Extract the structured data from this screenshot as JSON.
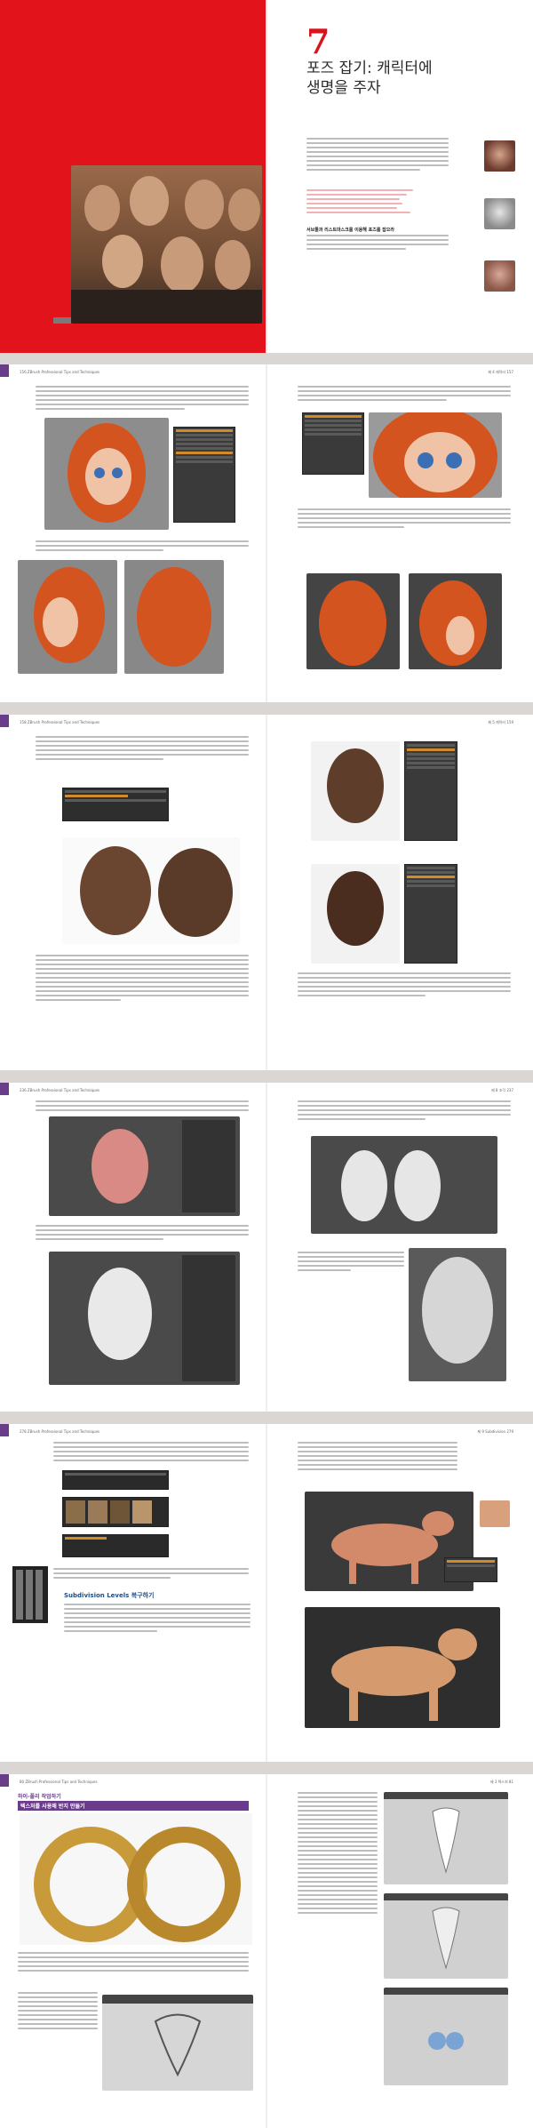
{
  "chapter": {
    "number": "7",
    "title_line1": "포즈 잡기: 캐릭터에",
    "title_line2": "생명을 주자",
    "bullets": [
      "",
      "",
      "",
      "",
      "",
      ""
    ],
    "subhead": "서브툴과 리스트마스크를 이용해 포즈를 잡으라"
  },
  "spreads": [
    {
      "left_folio": "156",
      "right_folio": "157",
      "left_head": "ZBrush Professional Tips and Techniques",
      "right_head": "제 4 캐릭터"
    },
    {
      "left_folio": "158",
      "right_folio": "159",
      "left_head": "ZBrush Professional Tips and Techniques",
      "right_head": "제 5 캐릭터"
    },
    {
      "left_folio": "236",
      "right_folio": "237",
      "left_head": "ZBrush Professional Tips and Techniques",
      "right_head": "제 8 조각"
    },
    {
      "left_folio": "278",
      "right_folio": "279",
      "left_head": "ZBrush Professional Tips and Techniques",
      "right_head": "제 9 Subdivision"
    },
    {
      "left_folio": "80",
      "right_folio": "81",
      "left_head": "ZBrush Professional Tips and Techniques",
      "right_head": "제 3 텍스처"
    }
  ],
  "section": {
    "subdivision_heading": "Subdivision Levels 복구하기",
    "purple_label": "하이-폴리 작업하기",
    "purple_label2": "텍스처를 사용해 반지 만들기"
  },
  "colors": {
    "accent_red": "#d8141e",
    "purple": "#6a3c8c",
    "skin": "#c79b7a",
    "hair": "#d4541f",
    "clay": "#d98a84"
  }
}
